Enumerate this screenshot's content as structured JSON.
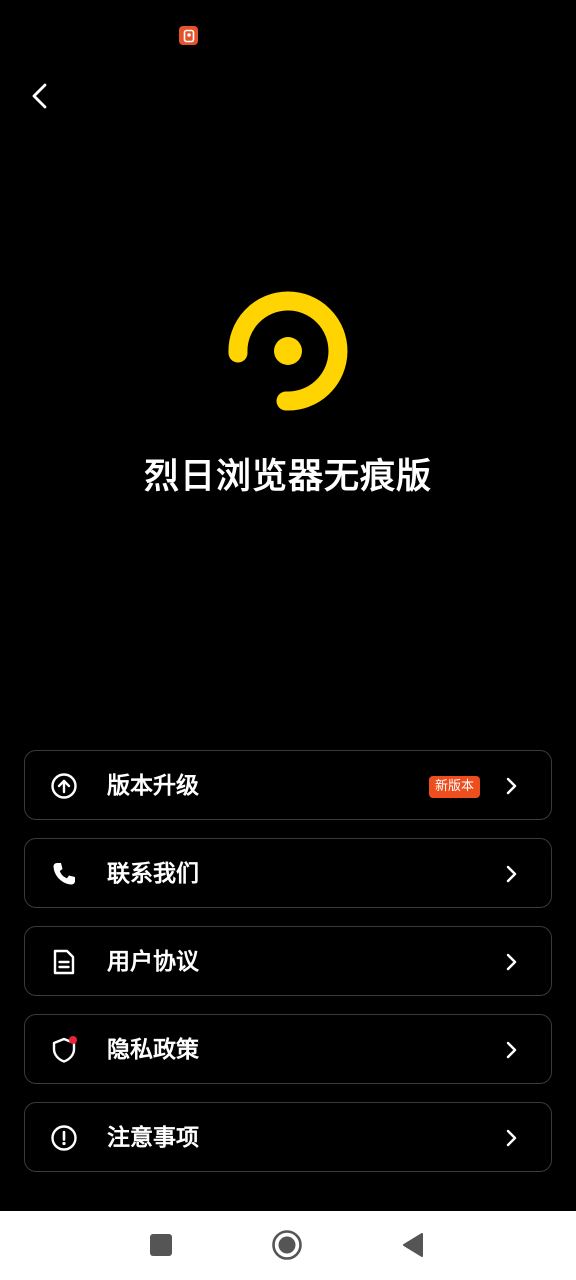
{
  "app": {
    "name": "烈日浏览器无痕版",
    "accent_color": "#ffd400",
    "badge_color": "#ee4d1d"
  },
  "status_bar": {
    "notification_icon": "app-notification-icon"
  },
  "header": {
    "back_icon": "chevron-left-icon"
  },
  "menu": {
    "items": [
      {
        "label": "版本升级",
        "icon": "arrow-up-circle-icon",
        "badge": "新版本"
      },
      {
        "label": "联系我们",
        "icon": "phone-icon"
      },
      {
        "label": "用户协议",
        "icon": "document-icon"
      },
      {
        "label": "隐私政策",
        "icon": "shield-icon"
      },
      {
        "label": "注意事项",
        "icon": "exclamation-circle-icon"
      }
    ]
  },
  "nav_bar": {
    "buttons": [
      "square-icon",
      "circle-home-icon",
      "triangle-back-icon"
    ]
  }
}
